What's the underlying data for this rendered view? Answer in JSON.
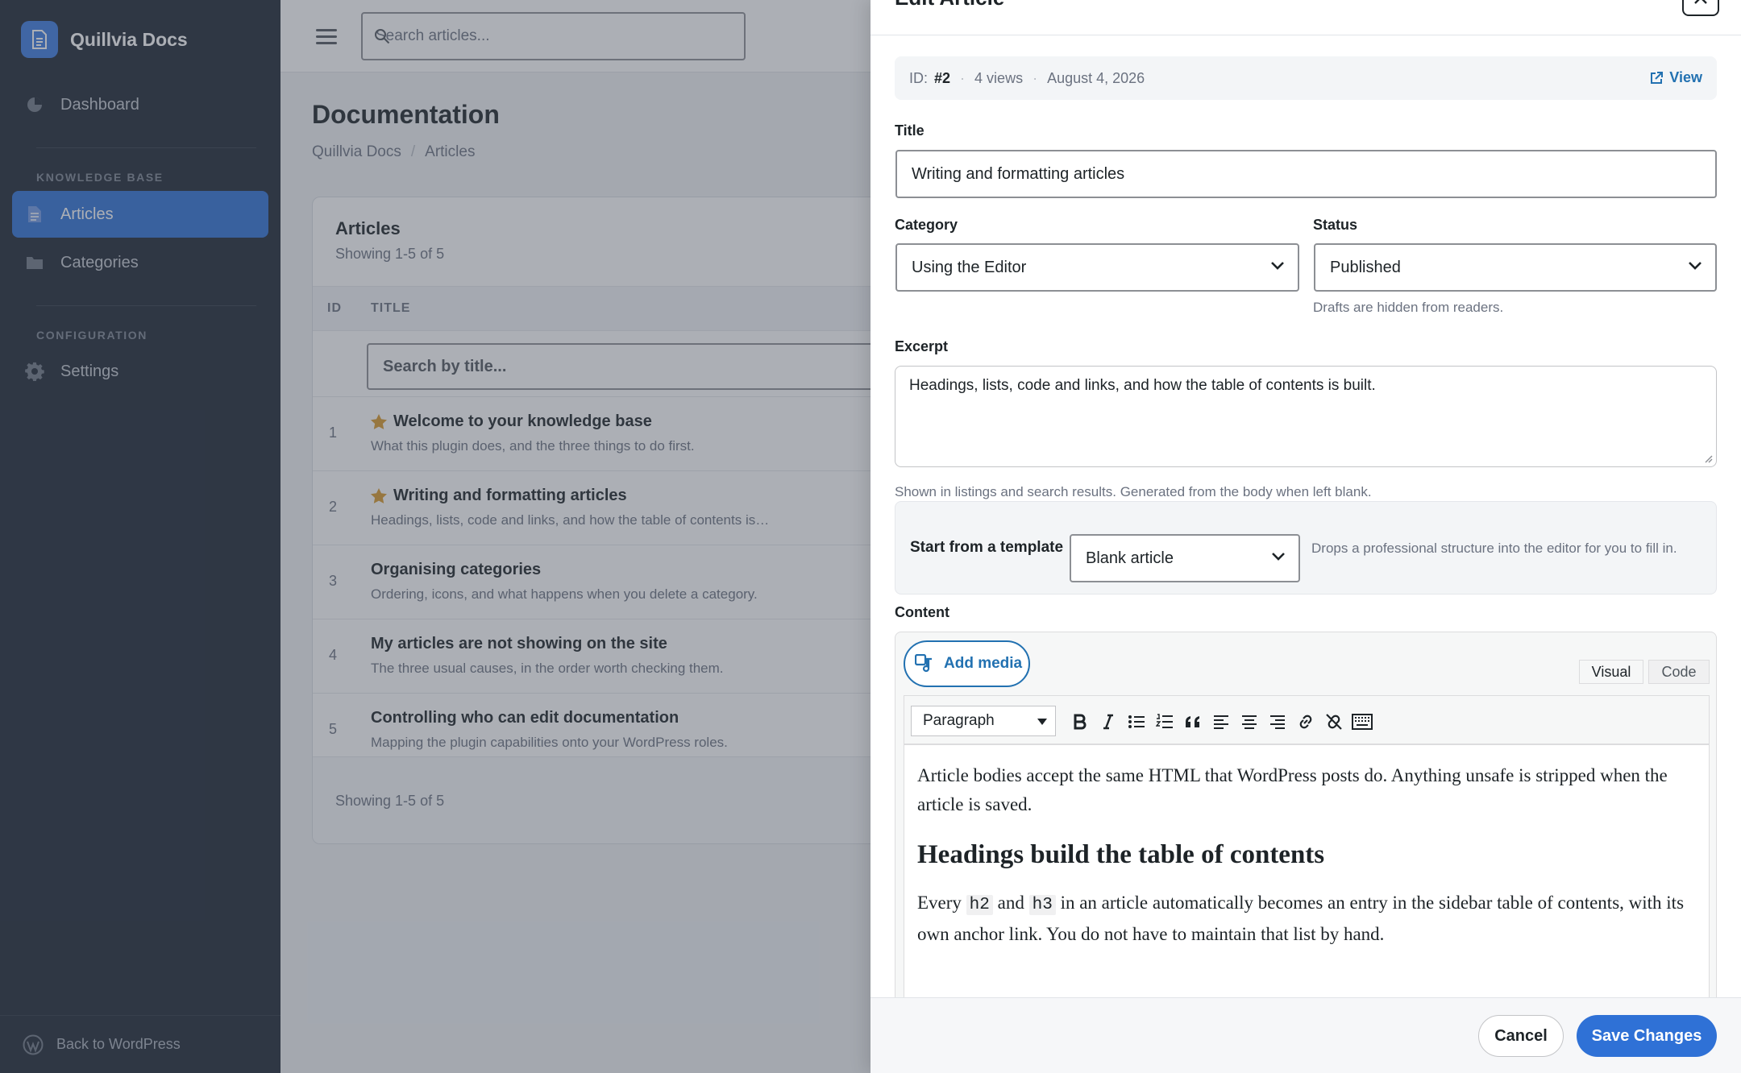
{
  "app": {
    "name": "Quillvia Docs"
  },
  "sidebar": {
    "dashboard": "Dashboard",
    "section_knowledge": "KNOWLEDGE BASE",
    "articles": "Articles",
    "categories": "Categories",
    "section_config": "CONFIGURATION",
    "settings": "Settings",
    "footer": "Back to WordPress"
  },
  "topbar": {
    "search_placeholder": "Search articles..."
  },
  "page": {
    "title": "Documentation",
    "breadcrumb": [
      "Quillvia Docs",
      "Articles"
    ],
    "breadcrumb_sep": "/"
  },
  "list": {
    "title": "Articles",
    "showing": "Showing 1-5 of 5",
    "columns": {
      "id": "ID",
      "title": "TITLE"
    },
    "filter_placeholder": "Search by title...",
    "rows": [
      {
        "id": "1",
        "title": "Welcome to your knowledge base",
        "excerpt": "What this plugin does, and the three things to do first.",
        "starred": true
      },
      {
        "id": "2",
        "title": "Writing and formatting articles",
        "excerpt": "Headings, lists, code and links, and how the table of contents is…",
        "starred": true
      },
      {
        "id": "3",
        "title": "Organising categories",
        "excerpt": "Ordering, icons, and what happens when you delete a category.",
        "starred": false
      },
      {
        "id": "4",
        "title": "My articles are not showing on the site",
        "excerpt": "The three usual causes, in the order worth checking them.",
        "starred": false
      },
      {
        "id": "5",
        "title": "Controlling who can edit documentation",
        "excerpt": "Mapping the plugin capabilities onto your WordPress roles.",
        "starred": false
      }
    ],
    "footer": "Showing 1-5 of 5"
  },
  "edit": {
    "heading": "Edit Article",
    "meta": {
      "id_label": "ID:",
      "id_value": "#2",
      "views": "4 views",
      "date": "August 4, 2026",
      "view_link": "View"
    },
    "title_label": "Title",
    "title_value": "Writing and formatting articles",
    "category_label": "Category",
    "category_value": "Using the Editor",
    "status_label": "Status",
    "status_value": "Published",
    "status_help": "Drafts are hidden from readers.",
    "excerpt_label": "Excerpt",
    "excerpt_value": "Headings, lists, code and links, and how the table of contents is built.",
    "excerpt_help": "Shown in listings and search results. Generated from the body when left blank.",
    "template_label": "Start from a template",
    "template_value": "Blank article",
    "template_help": "Drops a professional structure into the editor for you to fill in.",
    "content_label": "Content",
    "add_media": "Add media",
    "tab_visual": "Visual",
    "tab_code": "Code",
    "format_value": "Paragraph",
    "body": {
      "p1": "Article bodies accept the same HTML that WordPress posts do. Anything unsafe is stripped when the article is saved.",
      "h2": "Headings build the table of contents",
      "p2_a": "Every",
      "code1": "h2",
      "p2_b": "and",
      "code2": "h3",
      "p2_c": "in an article automatically becomes an entry in the sidebar table of contents, with its own anchor link. You do not have to maintain that list by hand."
    },
    "cancel": "Cancel",
    "save": "Save Changes"
  },
  "colors": {
    "accent": "#2f71d6",
    "sidebar_bg": "#1d2532",
    "star": "#d99a2b",
    "link": "#2271b1"
  }
}
